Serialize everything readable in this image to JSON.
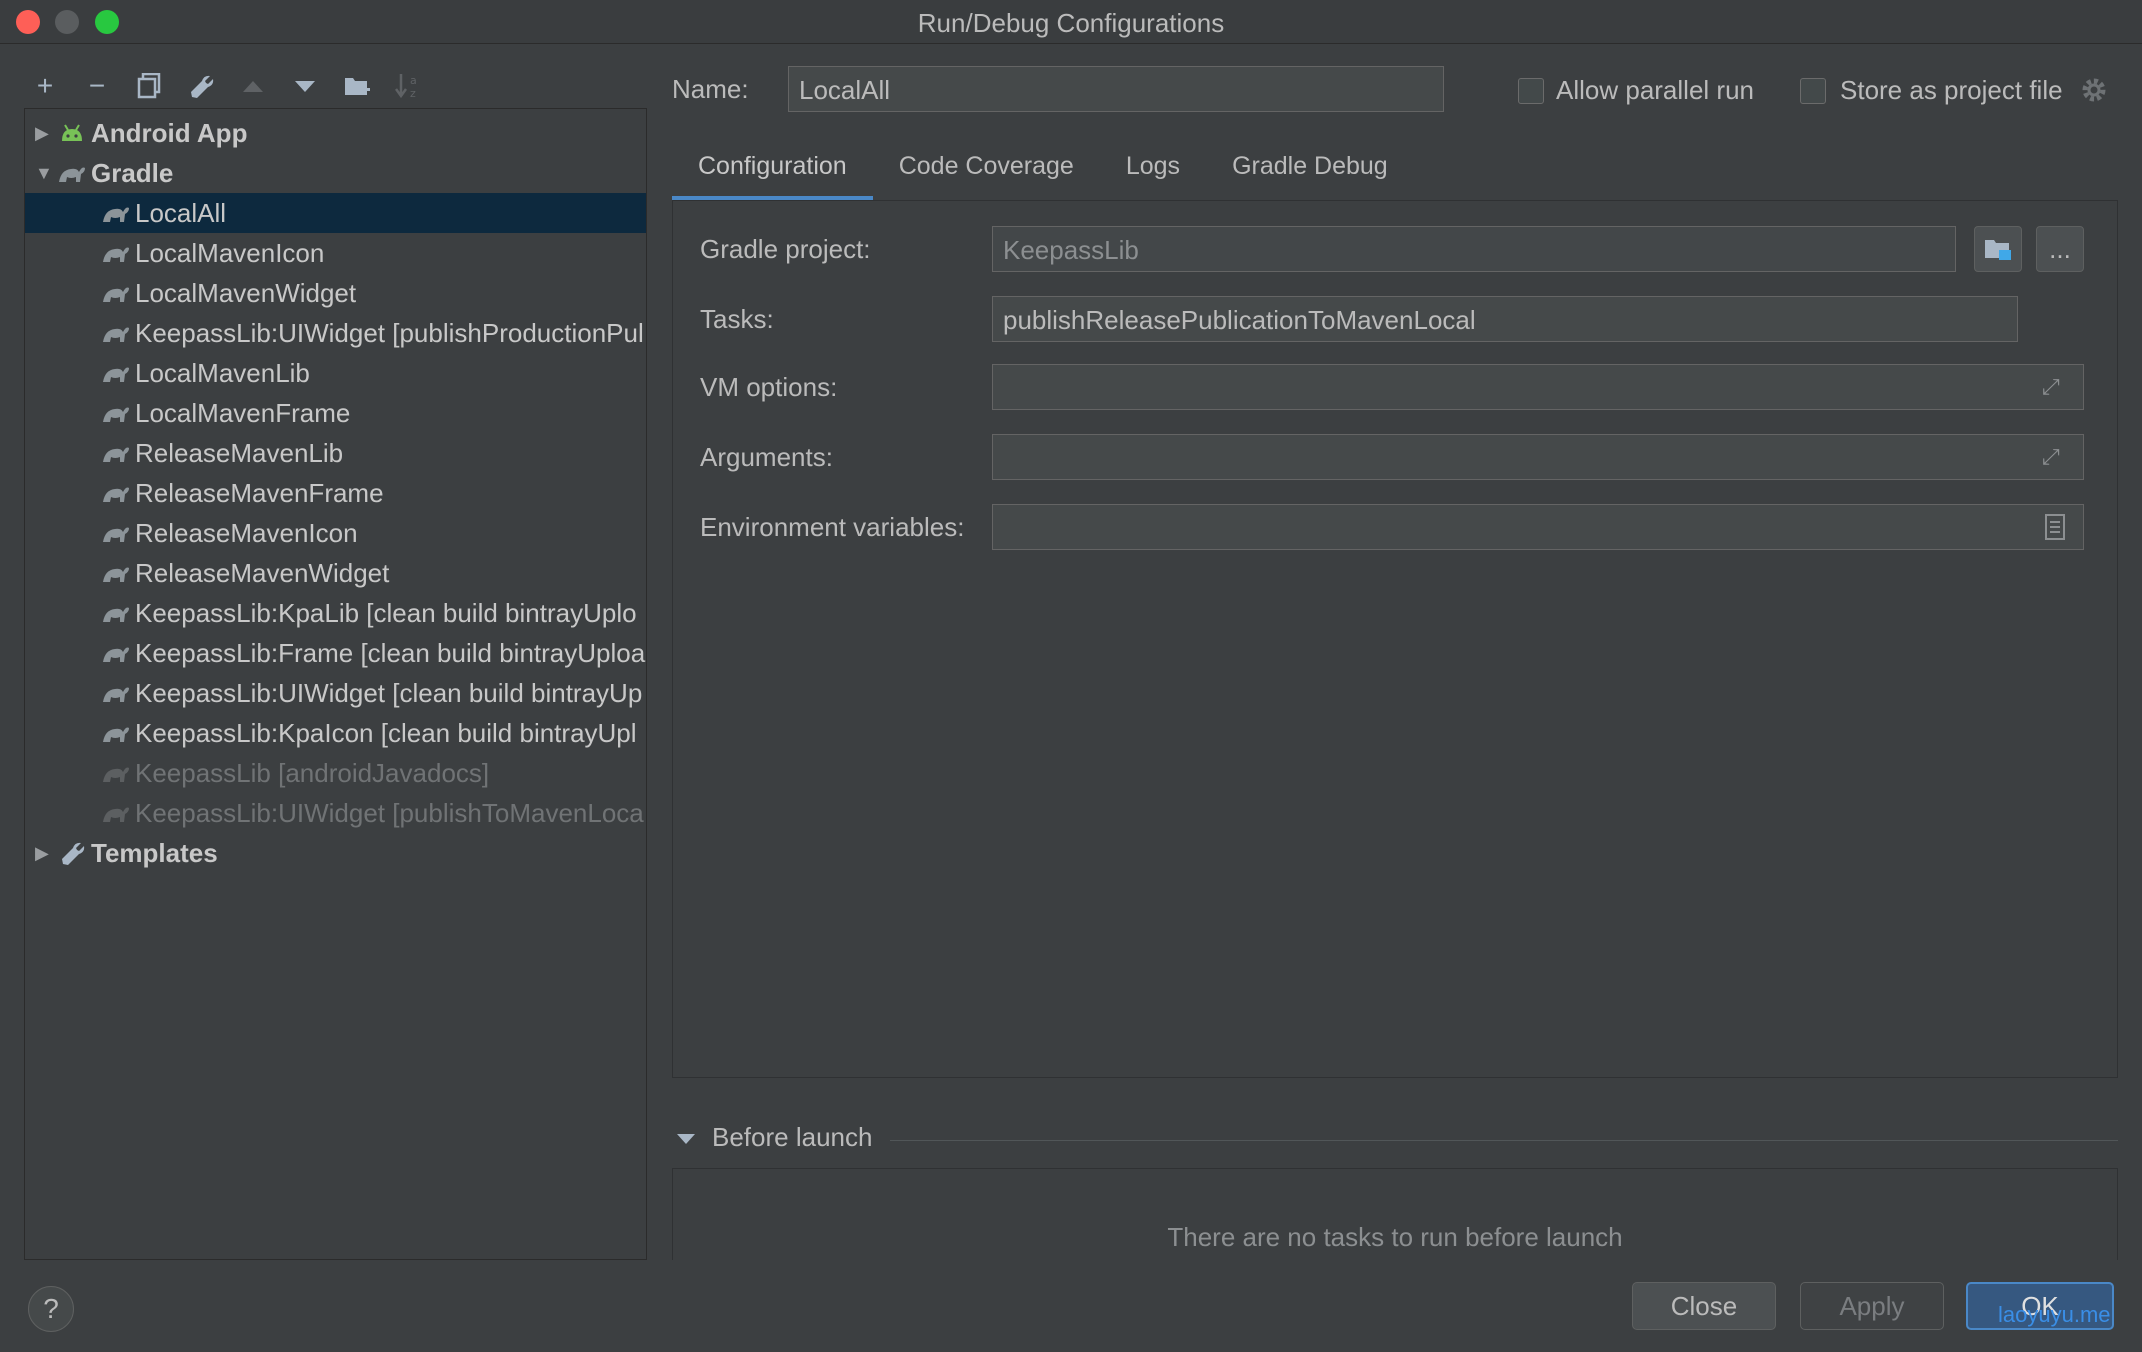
{
  "window": {
    "title": "Run/Debug Configurations"
  },
  "toolbar": {
    "add": "+",
    "remove": "−",
    "copy": "⧉",
    "edit": "🔧",
    "up": "▲",
    "down": "▼",
    "folder": "📁",
    "sort": "↓a"
  },
  "tree": {
    "android_app": "Android App",
    "gradle": "Gradle",
    "templates": "Templates",
    "items": [
      "LocalAll",
      "LocalMavenIcon",
      "LocalMavenWidget",
      "KeepassLib:UIWidget [publishProductionPul",
      "LocalMavenLib",
      "LocalMavenFrame",
      "ReleaseMavenLib",
      "ReleaseMavenFrame",
      "ReleaseMavenIcon",
      "ReleaseMavenWidget",
      "KeepassLib:KpaLib [clean build bintrayUplo",
      "KeepassLib:Frame [clean build bintrayUploa",
      "KeepassLib:UIWidget [clean build bintrayUp",
      "KeepassLib:KpaIcon [clean build bintrayUpl",
      "KeepassLib [androidJavadocs]",
      "KeepassLib:UIWidget [publishToMavenLoca"
    ]
  },
  "header": {
    "name_label": "Name:",
    "name_value": "LocalAll",
    "allow_parallel": "Allow parallel run",
    "store_project": "Store as project file"
  },
  "tabs": [
    "Configuration",
    "Code Coverage",
    "Logs",
    "Gradle Debug"
  ],
  "config": {
    "gradle_project_label": "Gradle project:",
    "gradle_project_value": "KeepassLib",
    "tasks_label": "Tasks:",
    "tasks_value": "publishReleasePublicationToMavenLocal",
    "vm_options_label": "VM options:",
    "vm_options_value": "",
    "arguments_label": "Arguments:",
    "arguments_value": "",
    "env_label": "Environment variables:",
    "env_value": "",
    "browse_label": "..."
  },
  "before_launch": {
    "title": "Before launch",
    "empty": "There are no tasks to run before launch"
  },
  "buttons": {
    "help": "?",
    "close": "Close",
    "apply": "Apply",
    "ok": "OK"
  },
  "watermark": "laoyuyu.me"
}
